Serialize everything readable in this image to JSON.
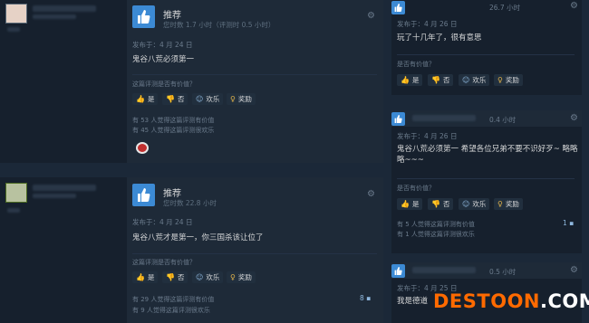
{
  "reviews_left": [
    {
      "recommend_label": "推荐",
      "hours": "您时数 1.7 小时（评测时 0.5 小时）",
      "posted": "发布于：4 月 24 日",
      "text": "鬼谷八荒必须第一",
      "helpful_question": "这篇评测是否有价值？",
      "buttons": {
        "yes": "是",
        "no": "否",
        "funny": "欢乐",
        "award": "奖励"
      },
      "stats": [
        "有 53 人觉得这篇评测有价值",
        "有 45 人觉得这篇评测很欢乐"
      ]
    },
    {
      "recommend_label": "推荐",
      "hours": "您时数 22.8 小时",
      "posted": "发布于：4 月 24 日",
      "text": "鬼谷八荒才是第一，你三国杀该让位了",
      "helpful_question": "这篇评测是否有价值？",
      "buttons": {
        "yes": "是",
        "no": "否",
        "funny": "欢乐",
        "award": "奖励"
      },
      "stats": [
        "有 29 人觉得这篇评测有价值",
        "有 9 人觉得这篇评测很欢乐"
      ],
      "comments": "8"
    }
  ],
  "reviews_right": [
    {
      "hours": "26.7 小时",
      "posted": "发布于：4 月 26 日",
      "text": "玩了十几年了，很有意思",
      "helpful_question": "是否有价值？",
      "buttons": {
        "yes": "是",
        "no": "否",
        "funny": "欢乐",
        "award": "奖励"
      }
    },
    {
      "hours": "0.4 小时",
      "posted": "发布于：4 月 26 日",
      "text": "鬼谷八荒必须第一 希望各位兄弟不要不识好歹~ 略略略~~~",
      "helpful_question": "是否有价值？",
      "buttons": {
        "yes": "是",
        "no": "否",
        "funny": "欢乐",
        "award": "奖励"
      },
      "stats": [
        "有 5 人觉得这篇评测有价值",
        "有 1 人觉得这篇评测很欢乐"
      ],
      "comments": "1"
    },
    {
      "hours": "0.5 小时",
      "posted": "发布于：4 月 25 日",
      "text": "我是德道"
    }
  ],
  "watermark": {
    "part1": "DESTOON",
    "part2": ".COM"
  },
  "colors": {
    "background": "#1b2838",
    "thumb_blue": "#3c8ad4",
    "link_blue": "#8fb8de",
    "award_gold": "#e2b34a"
  },
  "icons": [
    "thumbs-up-icon",
    "thumbs-down-icon",
    "smiley-icon",
    "award-icon",
    "gear-icon",
    "comment-icon"
  ]
}
